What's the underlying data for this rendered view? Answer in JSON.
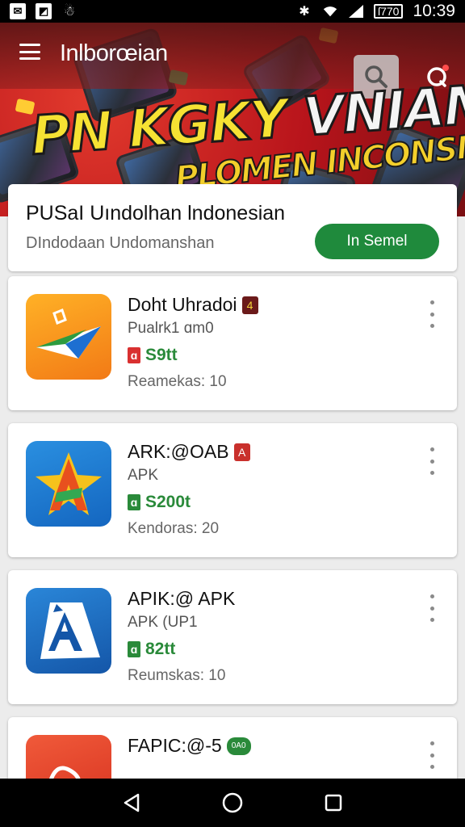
{
  "status_bar": {
    "time": "10:39",
    "battery": "ſ770"
  },
  "header": {
    "title": "Inlborœian",
    "search_icon": "search-icon",
    "notification_icon": "notification-icon"
  },
  "banner": {
    "line1_a": "PN KGKY",
    "line1_b": "VNIAM",
    "line2": "PLOMEN INCONSIA!"
  },
  "intro_card": {
    "title": "PUSaI Uındolhan lndonesian",
    "subtitle": "DIndodaan Undomanshan",
    "button_label": "In Semel"
  },
  "apps": [
    {
      "name": "Doht Uhradoi",
      "badge": "4",
      "developer": "Pualrk1 ɑm0",
      "rating": "S9tt",
      "meta": "Reamekas: 10",
      "icon": "paper-plane-icon"
    },
    {
      "name": "ARK:@OAB",
      "badge": "A",
      "developer": "APK",
      "rating": "S200t",
      "meta": "Kendoras: 20",
      "icon": "letter-a-star-icon"
    },
    {
      "name": "APIK:@ APK",
      "badge": "",
      "developer": "APK (UP1",
      "rating": "82tt",
      "meta": "Reumskas: 10",
      "icon": "letter-a-box-icon"
    },
    {
      "name": "FAPIC:@-5",
      "badge": "0A0",
      "developer": "",
      "rating": "",
      "meta": "",
      "icon": "scribble-icon"
    }
  ],
  "colors": {
    "accent_green": "#1f8a3c",
    "banner_red": "#b8141b",
    "banner_yellow": "#f6e233"
  }
}
